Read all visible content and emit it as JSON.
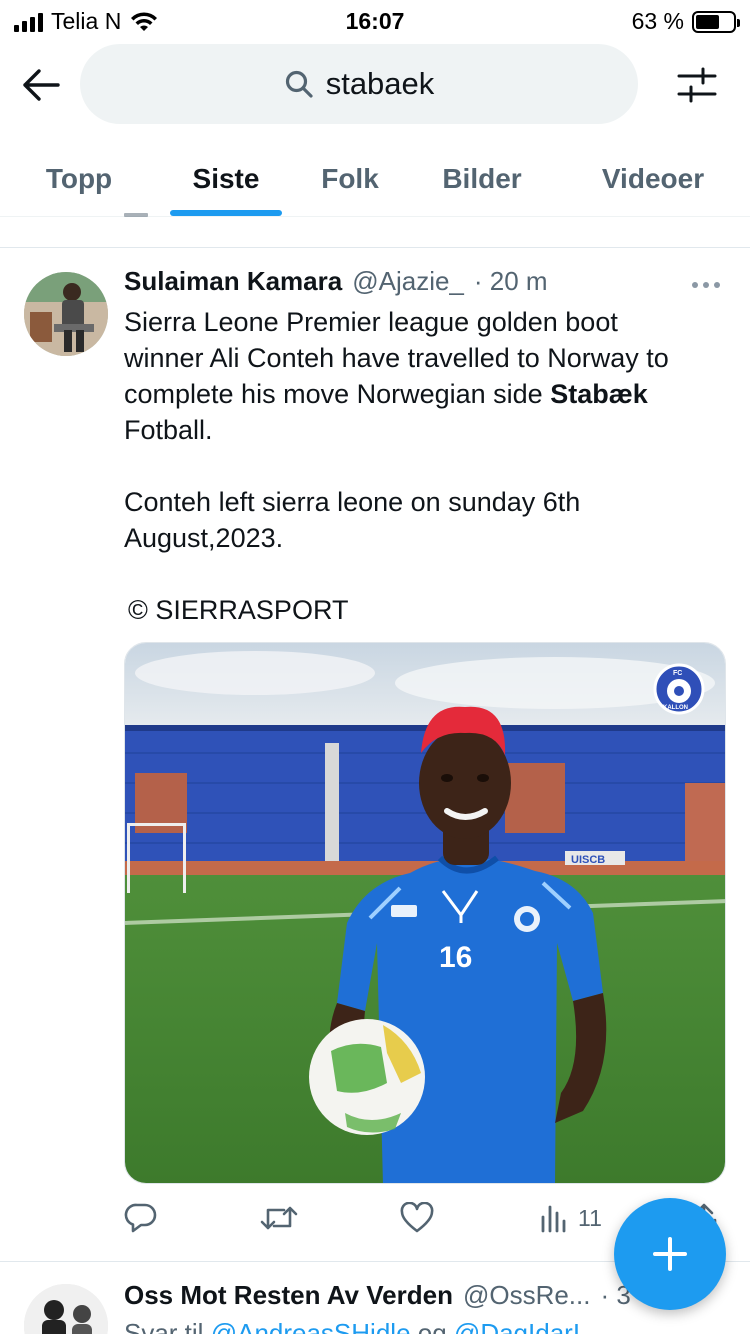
{
  "status_bar": {
    "carrier": "Telia N",
    "time": "16:07",
    "battery": "63 %",
    "battery_level": 0.63
  },
  "search": {
    "query": "stabaek",
    "icons": {
      "back": "arrow-left-icon",
      "search": "search-icon",
      "filter": "sliders-icon"
    }
  },
  "tabs": [
    {
      "label": "Topp"
    },
    {
      "label": "Siste",
      "active": true
    },
    {
      "label": "Folk"
    },
    {
      "label": "Bilder"
    },
    {
      "label": "Videoer"
    }
  ],
  "tweet": {
    "author": "Sulaiman Kamara",
    "handle": "@Ajazie_",
    "time": "· 20 m",
    "text_lines": [
      "Sierra Leone Premier league golden boot",
      "winner Ali Conteh have travelled to Norway to",
      "complete his move Norwegian side ",
      "Stabæk",
      "Fotball.",
      "Conteh left sierra leone on sunday 6th",
      "August,2023.",
      "© SIERRASPORT"
    ],
    "media": {
      "jersey_number": "16",
      "badge_top": "FC",
      "badge_bottom": "KALLON",
      "banner_text": "UISCB"
    },
    "actions": {
      "reply_icon": "reply-icon",
      "retweet_icon": "retweet-icon",
      "like_icon": "heart-icon",
      "views_icon": "bar-chart-icon",
      "views": "11",
      "share_icon": "share-icon"
    }
  },
  "next_tweet": {
    "author": "Oss Mot Resten Av Verden",
    "handle": "@OssRe...",
    "time": "· 3",
    "reply_prefix": "Svar til",
    "reply_to_1": "@AndreasSHidle",
    "reply_and": "og",
    "reply_to_2": "@DagIdarI"
  },
  "fab": {
    "icon": "plus-icon"
  },
  "colors": {
    "accent": "#1d9bf0",
    "text": "#0f1419",
    "muted": "#536471"
  }
}
